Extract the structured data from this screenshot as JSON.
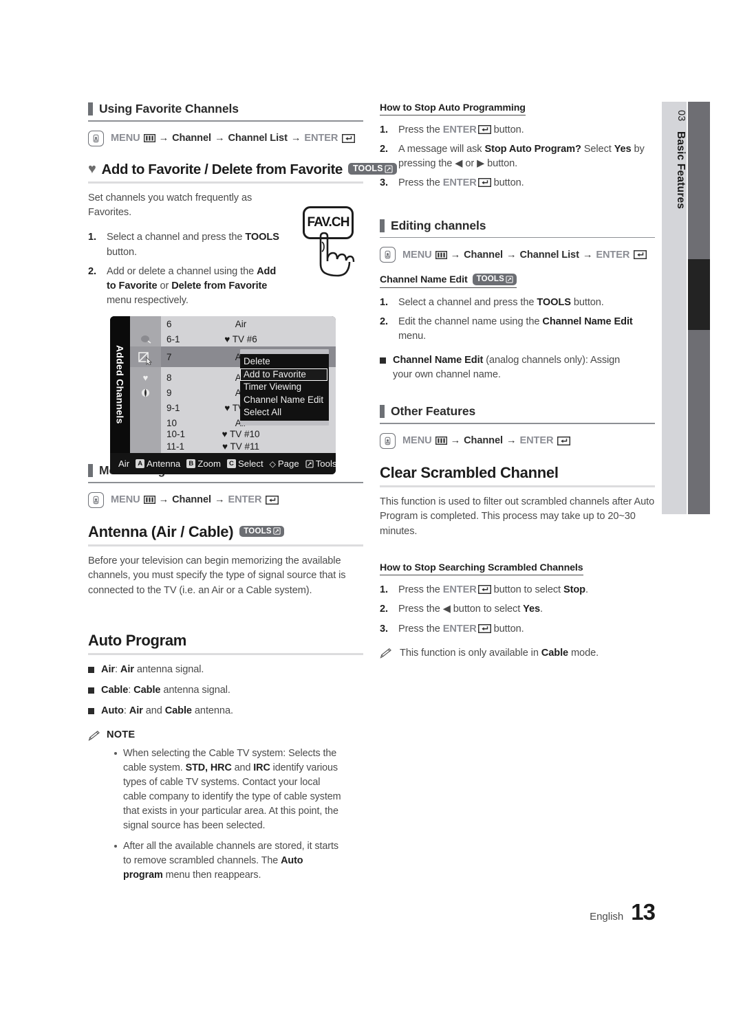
{
  "side_tab": {
    "chapter_number": "03",
    "chapter_title": "Basic Features"
  },
  "footer": {
    "language": "English",
    "page_number": "13"
  },
  "left_column": {
    "using_favorite_channels": {
      "heading": "Using Favorite Channels",
      "path": {
        "menu": "MENU",
        "steps": [
          "Channel",
          "Channel List"
        ],
        "enter": "ENTER"
      }
    },
    "add_delete_favorite": {
      "heading": "Add to Favorite / Delete from Favorite",
      "tools_badge": "TOOLS",
      "intro": "Set channels you watch frequently as Favorites.",
      "steps": [
        "Select a channel and press the TOOLS button.",
        "Add or delete a channel using the Add to Favorite or Delete from Favorite menu respectively."
      ],
      "remote_key_label": "FAV.CH"
    },
    "channel_list_screenshot": {
      "side_label": "Added Channels",
      "rows": [
        {
          "number": "6",
          "name": "Air",
          "favorite": false
        },
        {
          "number": "6-1",
          "name": "TV #6",
          "favorite": true
        },
        {
          "number": "7",
          "name": "Air",
          "favorite": false,
          "highlighted": true
        },
        {
          "number": "8",
          "name": "Air",
          "favorite": false
        },
        {
          "number": "9",
          "name": "Air",
          "favorite": false
        },
        {
          "number": "9-1",
          "name": "TV #9",
          "favorite": true
        },
        {
          "number": "10",
          "name": "Air",
          "favorite": false
        },
        {
          "number": "10-1",
          "name": "TV #10",
          "favorite": true
        },
        {
          "number": "11-1",
          "name": "TV #11",
          "favorite": true
        }
      ],
      "popup_menu": {
        "items": [
          "Delete",
          "Add to Favorite",
          "Timer Viewing",
          "Channel Name Edit",
          "Select All"
        ],
        "selected": "Add to Favorite"
      },
      "bottom_bar": {
        "mode": "Air",
        "buttons": [
          {
            "key": "A",
            "label": "Antenna"
          },
          {
            "key": "B",
            "label": "Zoom"
          },
          {
            "key": "C",
            "label": "Select"
          },
          {
            "key": "◇",
            "label": "Page"
          },
          {
            "key": "tools",
            "label": "Tools"
          }
        ]
      }
    },
    "memorizing_channels": {
      "heading": "Memorizing channels",
      "path": {
        "menu": "MENU",
        "steps": [
          "Channel"
        ],
        "enter": "ENTER"
      }
    },
    "antenna": {
      "heading": "Antenna (Air / Cable)",
      "tools_badge": "TOOLS",
      "body": "Before your television can begin memorizing the available channels, you must specify the type of signal source that is connected to the TV (i.e. an Air or a Cable system)."
    },
    "auto_program": {
      "heading": "Auto Program",
      "bullets": [
        {
          "term": "Air",
          "bold_word": "Air",
          "rest": " antenna signal."
        },
        {
          "term": "Cable",
          "bold_word": "Cable",
          "rest": " antenna signal."
        },
        {
          "term": "Auto",
          "bold_word": "Air",
          "rest": " and Cable antenna."
        }
      ],
      "note_label": "NOTE",
      "notes": [
        "When selecting the Cable TV system: Selects the cable system. STD, HRC and IRC identify various types of cable TV systems. Contact your local cable company to identify the type of cable system that exists in your particular area. At this point, the signal source has been selected.",
        "After all the available channels are stored, it starts to remove scrambled channels. The Auto program menu then reappears."
      ]
    }
  },
  "right_column": {
    "stop_auto_programming": {
      "heading": "How to Stop Auto Programming",
      "steps": [
        "Press the ENTER button.",
        "A message will ask Stop Auto Program? Select Yes by pressing the ◀ or ▶ button.",
        "Press the ENTER button."
      ]
    },
    "editing_channels": {
      "heading": "Editing channels",
      "path": {
        "menu": "MENU",
        "steps": [
          "Channel",
          "Channel List"
        ],
        "enter": "ENTER"
      },
      "channel_name_edit": {
        "heading": "Channel Name Edit",
        "tools_badge": "TOOLS",
        "steps": [
          "Select a channel and press the TOOLS button.",
          "Edit the channel name using the Channel Name Edit menu."
        ],
        "bullet": "Channel Name Edit (analog channels only): Assign your own channel name."
      }
    },
    "other_features": {
      "heading": "Other Features",
      "path": {
        "menu": "MENU",
        "steps": [
          "Channel"
        ],
        "enter": "ENTER"
      }
    },
    "clear_scrambled_channel": {
      "heading": "Clear Scrambled Channel",
      "body": "This function is used to filter out scrambled channels after Auto Program is completed. This process may take up to 20~30 minutes.",
      "stop_search": {
        "heading": "How to Stop Searching Scrambled Channels",
        "steps": [
          "Press the ENTER button to select Stop.",
          "Press the ◀ button to select Yes.",
          "Press the ENTER button."
        ],
        "note": "This function is only available in Cable mode."
      }
    }
  },
  "colors": {
    "heading_bar": "#6d7075",
    "gray_text": "#8b8d94",
    "badge": "#6c6e73",
    "side_tab_bg": "#d4d5d9",
    "side_bar": "#6e6e73",
    "side_bar_active": "#232323"
  }
}
